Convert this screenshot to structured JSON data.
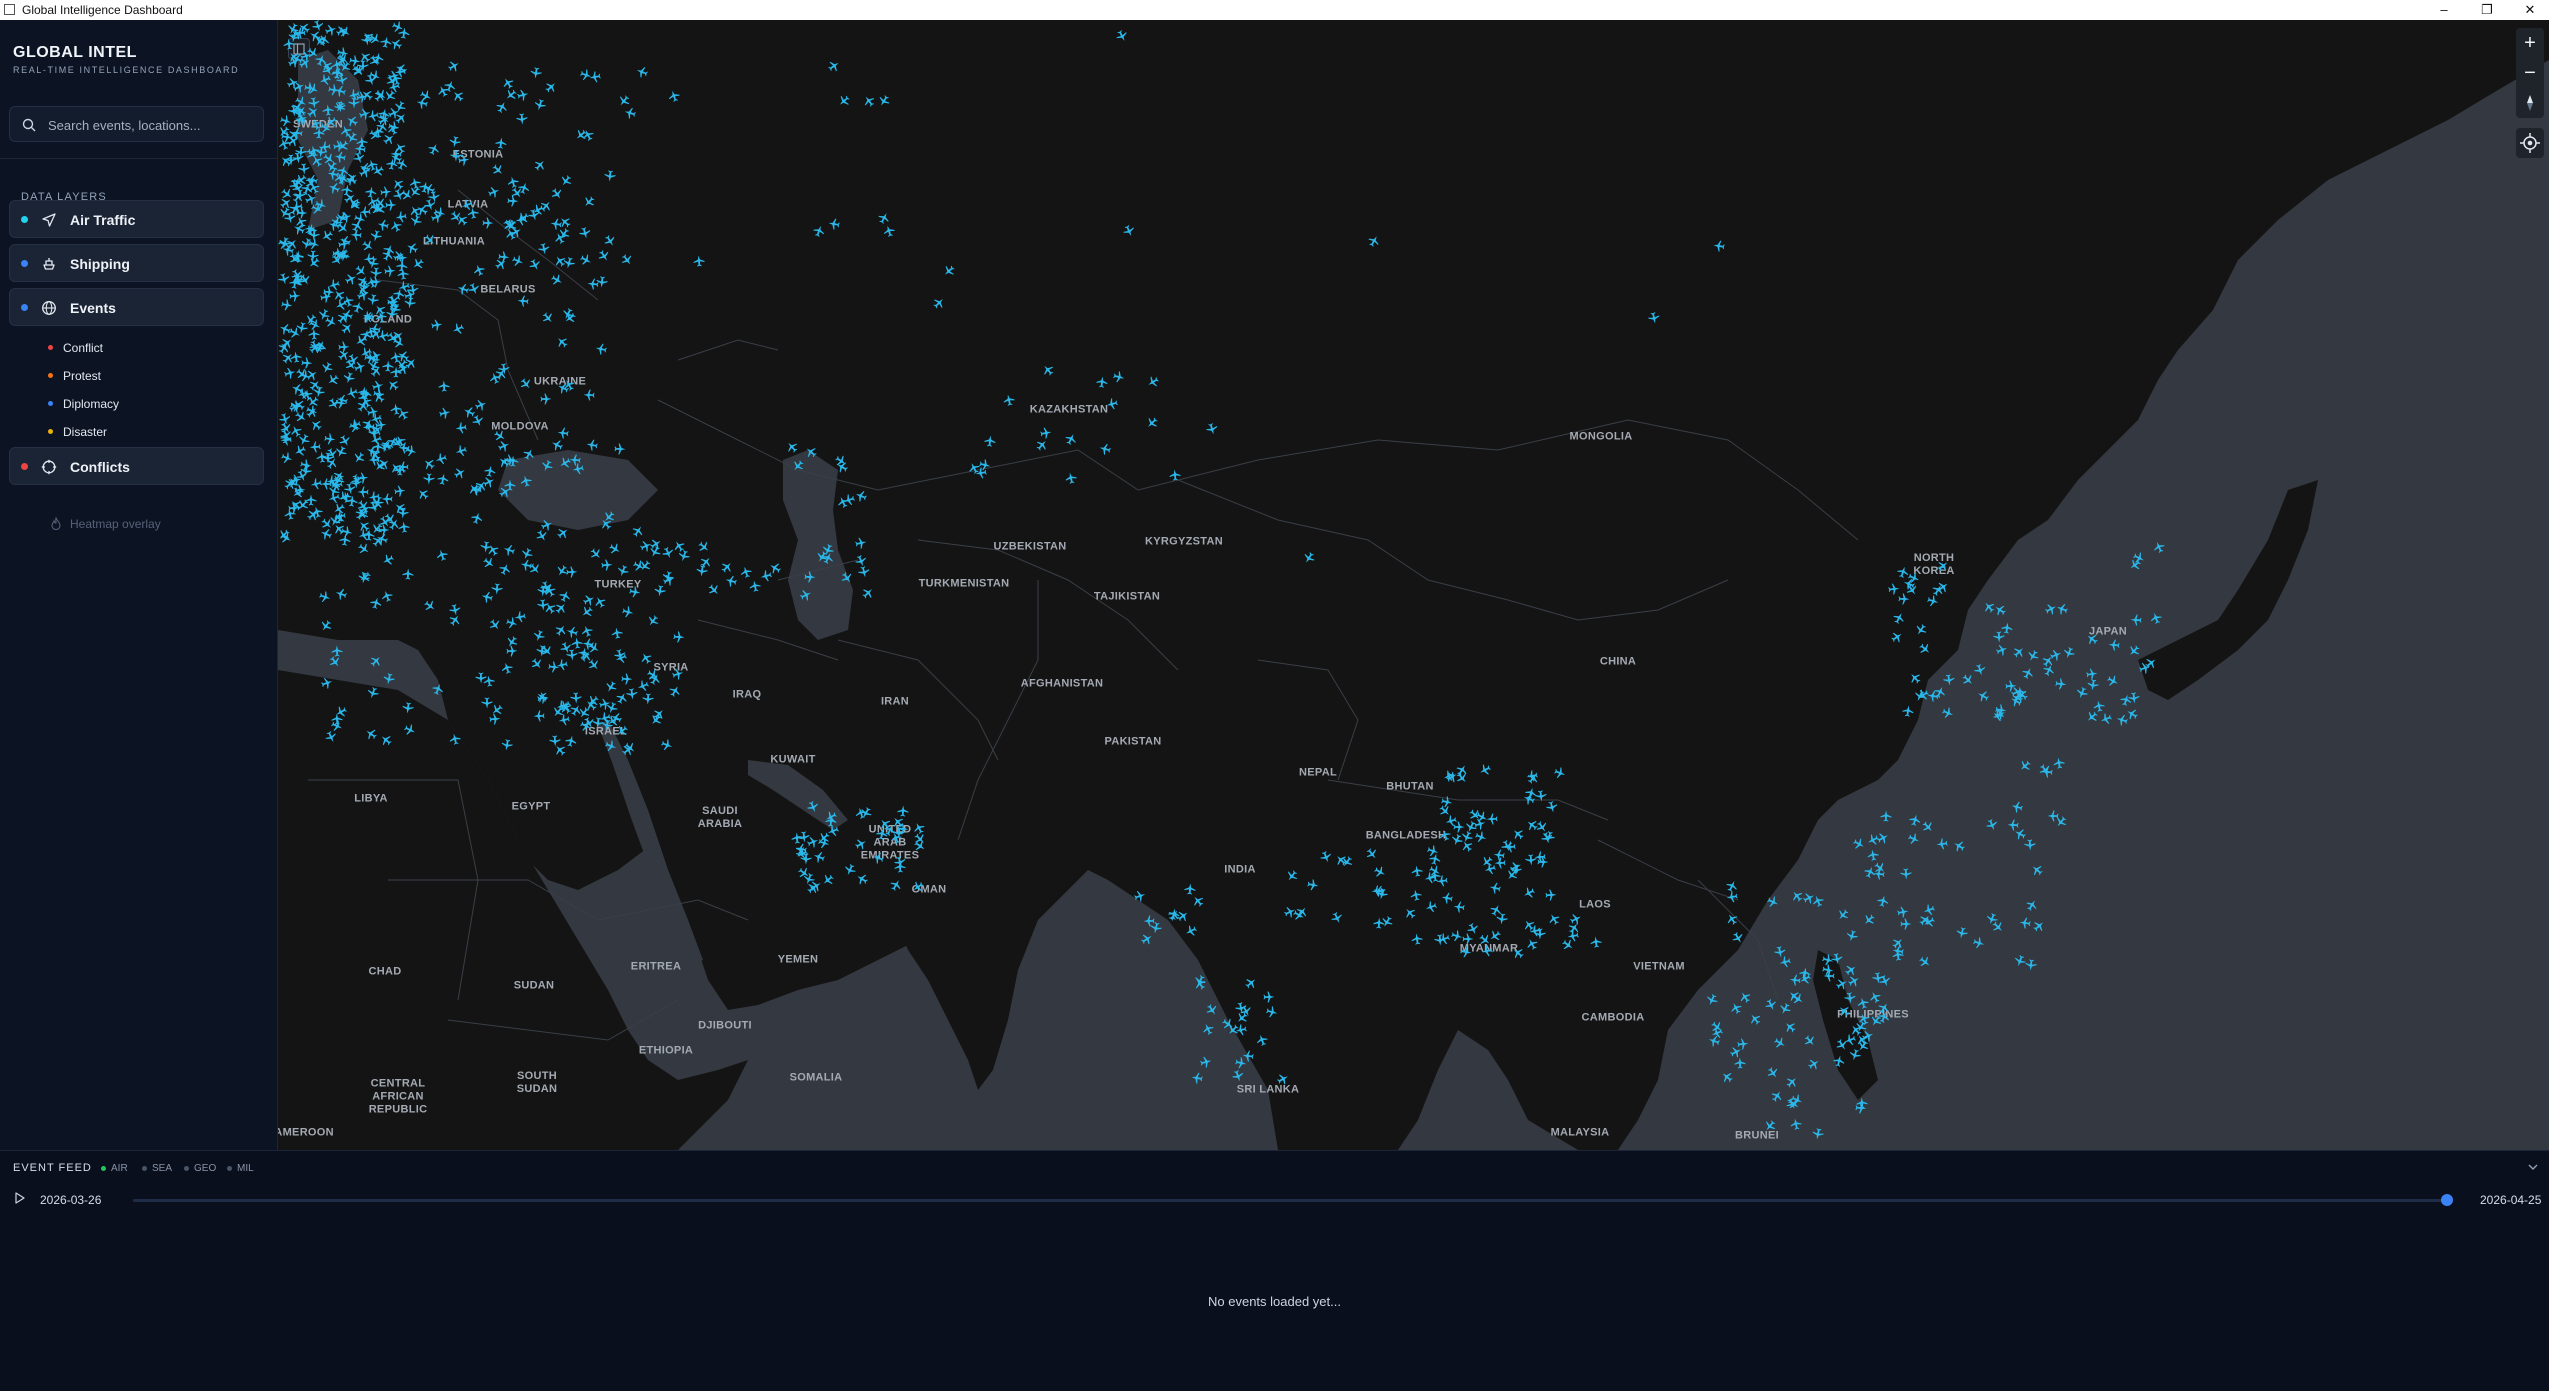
{
  "window": {
    "title": "Global Intelligence Dashboard"
  },
  "sidebar": {
    "brand_title": "GLOBAL INTEL",
    "brand_subtitle": "REAL-TIME INTELLIGENCE DASHBOARD",
    "search_placeholder": "Search events, locations...",
    "section_label": "DATA LAYERS",
    "layers": [
      {
        "label": "Air Traffic",
        "icon": "plane-icon",
        "color": "#22d3ee"
      },
      {
        "label": "Shipping",
        "icon": "ship-icon",
        "color": "#3b82f6"
      },
      {
        "label": "Events",
        "icon": "globe-icon",
        "color": "#3b82f6"
      },
      {
        "label": "Conflicts",
        "icon": "crosshair-icon",
        "color": "#ef4444"
      }
    ],
    "event_types": [
      {
        "label": "Conflict",
        "color": "#ef4444"
      },
      {
        "label": "Protest",
        "color": "#f97316"
      },
      {
        "label": "Diplomacy",
        "color": "#3b82f6"
      },
      {
        "label": "Disaster",
        "color": "#eab308"
      }
    ],
    "heatmap_label": "Heatmap overlay"
  },
  "map": {
    "labels": [
      "SWEDEN",
      "BELARUS",
      "POLAND",
      "UKRAINE",
      "MOLDOVA",
      "KAZAKHSTAN",
      "MONGOLIA",
      "UZBEKISTAN",
      "KYRGYZSTAN",
      "TURKMENISTAN",
      "TAJIKISTAN",
      "TURKEY",
      "SYRIA",
      "IRAQ",
      "IRAN",
      "AFGHANISTAN",
      "PAKISTAN",
      "CHINA",
      "NORTH KOREA",
      "JAPAN",
      "NEPAL",
      "BHUTAN",
      "BANGLADESH",
      "INDIA",
      "KUWAIT",
      "SAUDI ARABIA",
      "UNITED ARAB EMIRATES",
      "OMAN",
      "YEMEN",
      "LIBYA",
      "EGYPT",
      "ISRAEL",
      "CHAD",
      "SUDAN",
      "ERITREA",
      "DJIBOUTI",
      "ETHIOPIA",
      "SOMALIA",
      "SOUTH SUDAN",
      "CENTRAL AFRICAN REPUBLIC",
      "CAMEROON",
      "MYANMAR",
      "LAOS",
      "VIETNAM",
      "CAMBODIA",
      "PHILIPPINES",
      "SRI LANKA",
      "MALAYSIA",
      "BRUNEI",
      "LATVIA",
      "LITHUANIA",
      "ESTONIA"
    ],
    "aircraft_color": "#2ab7e9"
  },
  "feed": {
    "title": "EVENT FEED",
    "filters": [
      {
        "label": "AIR",
        "color": "#22c55e"
      },
      {
        "label": "SEA",
        "color": "#475569"
      },
      {
        "label": "GEO",
        "color": "#475569"
      },
      {
        "label": "MIL",
        "color": "#475569"
      }
    ],
    "start_date": "2026-03-26",
    "end_date": "2026-04-25",
    "timeline_position": 1.0,
    "empty_message": "No events loaded yet..."
  }
}
